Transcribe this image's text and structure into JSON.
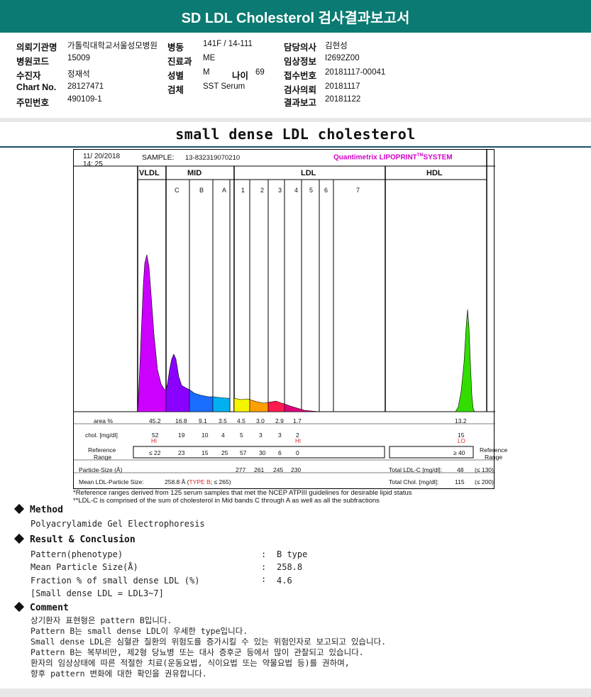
{
  "header": {
    "title": "SD LDL Cholesterol 검사결과보고서"
  },
  "info": {
    "col1": [
      {
        "label": "의뢰기관명",
        "value": "가톨릭대학교서울성모병원"
      },
      {
        "label": "병원코드",
        "value": "15009"
      },
      {
        "label": "수진자",
        "value": "정재석"
      },
      {
        "label": "Chart No.",
        "value": "28127471"
      },
      {
        "label": "주민번호",
        "value": "490109-1"
      }
    ],
    "col2": [
      {
        "label": "병동",
        "value": "141F / 14-111"
      },
      {
        "label": "진료과",
        "value": "ME"
      },
      {
        "label": "성별",
        "value": "M"
      },
      {
        "label": "검체",
        "value": "SST Serum"
      }
    ],
    "age": {
      "label": "나이",
      "value": "69"
    },
    "col3": [
      {
        "label": "담당의사",
        "value": "김현성"
      },
      {
        "label": "임상정보",
        "value": "I2692Z00"
      },
      {
        "label": "접수번호",
        "value": "20181117-00041"
      },
      {
        "label": "검사의뢰",
        "value": "20181117"
      },
      {
        "label": "결과보고",
        "value": "20181122"
      }
    ]
  },
  "section_title": "small dense LDL cholesterol",
  "report": {
    "date": "11/ 20/2018",
    "time": "14: 25",
    "sample_label": "SAMPLE:",
    "sample_id": "13-832319070210",
    "brand": "Quantimetrix LIPOPRINT",
    "brand_tm": "TM",
    "brand_suffix": "SYSTEM",
    "groups": {
      "vldl": "VLDL",
      "mid": "MID",
      "ldl": "LDL",
      "hdl": "HDL"
    },
    "bands": [
      "C",
      "B",
      "A",
      "1",
      "2",
      "3",
      "4",
      "5",
      "6",
      "7"
    ],
    "row_labels": {
      "area": "area %",
      "chol": "chol. [mg/dl]",
      "ref1": "Reference",
      "ref2": "Range",
      "particle": "Particle-Size (Å)",
      "mean": "Mean LDL-Particle Size:"
    },
    "area": [
      "45.2",
      "16.8",
      "9.1",
      "3.5",
      "4.5",
      "3.0",
      "2.9",
      "1.7"
    ],
    "area_hdl": "13.2",
    "chol": [
      "52",
      "19",
      "10",
      "4",
      "5",
      "3",
      "3",
      "2"
    ],
    "chol_hdl": "15",
    "flag_hi": "HI",
    "flag_lo": "LO",
    "ref": [
      "≤ 22",
      "23",
      "15",
      "25",
      "57",
      "30",
      "6",
      "0"
    ],
    "ref_hdl": "≥ 40",
    "ref_right1": "Reference",
    "ref_right2": "Range",
    "particle": [
      "277",
      "261",
      "245",
      "230"
    ],
    "total_ldl_label": "Total LDL-C [mg/dl]:",
    "total_ldl_value": "48",
    "total_ldl_ref": "(≤ 130)",
    "total_chol_label": "Total Chol. [mg/dl]:",
    "total_chol_value": "115",
    "total_chol_ref": "(≤ 200)",
    "mean_value": "258.8 Å",
    "mean_type_open": "(",
    "mean_type": "TYPE B",
    "mean_type_close": "; ≤ 265)"
  },
  "footnotes": [
    "*Reference ranges derived from 125 serum samples that met the NCEP ATPIII guidelines for desirable lipid status",
    "**LDL-C is comprised of the sum of cholesterol in Mid bands C through A as well as all the subfractions"
  ],
  "method": {
    "heading": "Method",
    "text": "Polyacrylamide Gel Electrophoresis"
  },
  "result": {
    "heading": "Result & Conclusion",
    "rows": [
      {
        "label": "Pattern(phenotype)",
        "sep": ":",
        "value": "B type"
      },
      {
        "label": "Mean Particle Size(Å)",
        "sep": ":",
        "value": "258.8"
      },
      {
        "label": "Fraction % of small dense LDL (%)",
        "sep": ":",
        "value": "4.6"
      }
    ],
    "note": "[Small dense LDL = LDL3~7]"
  },
  "comment": {
    "heading": "Comment",
    "lines": [
      "상기환자 표현형은 pattern B입니다.",
      "Pattern B는 small dense LDL이 우세한 type입니다.",
      "Small dense LDL은 심혈관 질환의 위험도를 증가시킬 수 있는 위험인자로 보고되고 있습니다.",
      "Pattern B는 복부비만, 제2형 당뇨병 또는 대사 증후군 등에서 많이 관찰되고 있습니다.",
      "환자의 임상상태에 따른 적절한 치료(운동요법, 식이요법 또는 약물요법 등)를 권하며,",
      "향후 pattern 변화에 대한 확인을 권유합니다."
    ]
  },
  "colors": {
    "header": "#0a7a72",
    "vldl": "#cc00ff",
    "midC": "#8a00ff",
    "midB": "#1a6dff",
    "midA": "#00b0f0",
    "ldl1": "#f5f500",
    "ldl2": "#ffa000",
    "ldl3": "#ff1a50",
    "ldl4": "#e0007a",
    "hdl": "#33dd00",
    "brand": "#d000c8",
    "flag": "#e02020"
  }
}
